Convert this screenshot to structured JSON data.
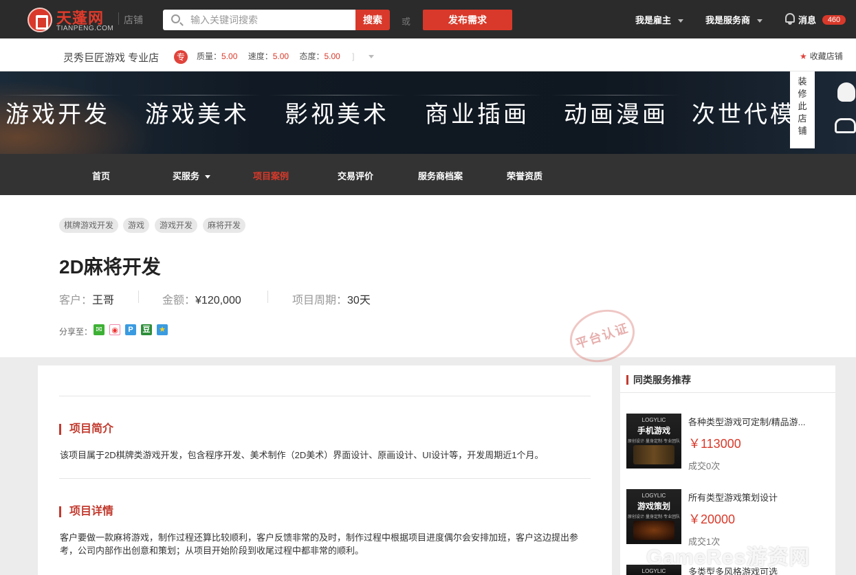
{
  "header": {
    "logo_cn": "天蓬网",
    "logo_en": "TIANPENG.COM",
    "shop_label": "店铺",
    "search_placeholder": "输入关键词搜索",
    "search_button": "搜索",
    "or_text": "或",
    "publish_button": "发布需求",
    "employer_menu": "我是雇主",
    "provider_menu": "我是服务商",
    "messages_label": "消息",
    "messages_count": "460"
  },
  "store": {
    "name": "灵秀巨匠游戏 专业店",
    "badge": "专",
    "quality_label": "质量：",
    "quality": "5.00",
    "speed_label": "速度：",
    "speed": "5.00",
    "attitude_label": "态度：",
    "attitude": "5.00",
    "ratings_end": "]",
    "favorite_label": "收藏店铺"
  },
  "banner": {
    "categories": [
      "游戏开发",
      "游戏美术",
      "影视美术",
      "商业插画",
      "动画漫画",
      "次世代模"
    ],
    "decorate_tab": [
      "装",
      "修",
      "此",
      "店",
      "铺"
    ]
  },
  "nav": {
    "items": [
      "首页",
      "买服务",
      "项目案例",
      "交易评价",
      "服务商档案",
      "荣誉资质"
    ],
    "active_index": 2
  },
  "project": {
    "tags": [
      "棋牌游戏开发",
      "游戏",
      "游戏开发",
      "麻将开发"
    ],
    "title": "2D麻将开发",
    "client_label": "客户：",
    "client": "王哥",
    "amount_label": "金额：",
    "amount": "¥120,000",
    "period_label": "项目周期：",
    "period": "30天",
    "share_label": "分享至：",
    "stamp_text": "平台认证"
  },
  "content": {
    "intro_title": "项目简介",
    "intro_text": "该项目属于2D棋牌类游戏开发，包含程序开发、美术制作（2D美术）界面设计、原画设计、UI设计等，开发周期近1个月。",
    "detail_title": "项目详情",
    "detail_text": "客户要做一款麻将游戏，制作过程还算比较顺利，客户反馈非常的及时，制作过程中根据项目进度偶尔会安排加班，客户这边提出参考，公司内部作出创意和策划；从项目开始阶段到收尾过程中都非常的顺利。"
  },
  "sidebar": {
    "title": "同类服务推荐",
    "items": [
      {
        "thumb_brand": "LOGYLIC",
        "thumb_title": "手机游戏",
        "thumb_sub": "原创设计·量身定制·专业团队",
        "name": "各种类型游戏可定制/精品游...",
        "price": "￥113000",
        "sold": "成交0次"
      },
      {
        "thumb_brand": "LOGYLIC",
        "thumb_title": "游戏策划",
        "thumb_sub": "原创设计·量身定制·专业团队",
        "name": "所有类型游戏策划设计",
        "price": "￥20000",
        "sold": "成交1次"
      },
      {
        "thumb_brand": "LOGYLIC",
        "thumb_title": "",
        "thumb_sub": "",
        "name": "多类型多风格游戏可选",
        "price": "",
        "sold": ""
      }
    ]
  },
  "watermark": "GameRes游资网",
  "colors": {
    "accent": "#d9392a",
    "topbar": "#2b2b2b",
    "nav": "#333333"
  }
}
